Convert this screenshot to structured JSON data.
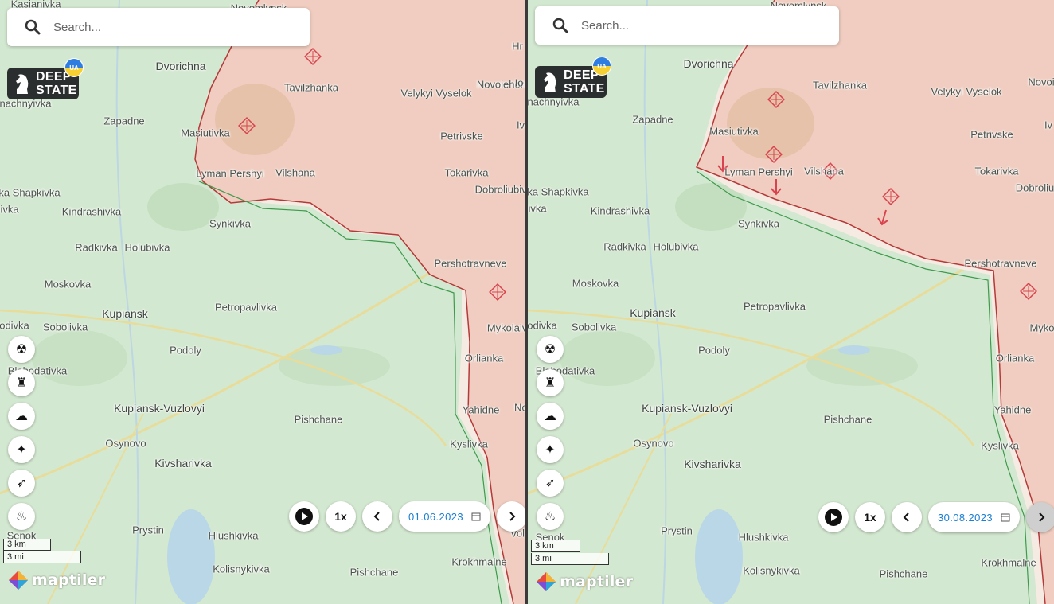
{
  "search": {
    "placeholder": "Search..."
  },
  "logo": {
    "line1": "DEEP",
    "line2": "STATE",
    "badge": "UA"
  },
  "colors": {
    "occupied": "#f0cdc0",
    "grey_zone": "#f6ebe2",
    "land": "#d3e8d0",
    "frontline": "#b43a3a",
    "date_text": "#1b7fd4"
  },
  "tools": [
    "radiation-icon",
    "monument-icon",
    "explosion-icon",
    "artillery-icon",
    "rocket-icon",
    "fire-icon"
  ],
  "panels": [
    {
      "date": "01.06.2023",
      "speed": "1x",
      "scale": {
        "km": "3 km",
        "mi": "3 mi"
      },
      "attribution": "maptiler",
      "places": [
        "Kasianivka",
        "Novomlynsk",
        "Dvorichna",
        "Tavilzhanka",
        "Velykyi Vyselok",
        "Novoiehorivka",
        "nachnyivka",
        "Zapadne",
        "Masiutivka",
        "Petrivske",
        "Lyman Pershyi",
        "Vilshana",
        "Tokarivka",
        "Dobroliubivka",
        "ka Shapkivka",
        "ivka",
        "Kindrashivka",
        "Synkivka",
        "Radkivka",
        "Holubivka",
        "Pershotravneve",
        "Moskovka",
        "Petropavlivka",
        "Kupiansk",
        "Sobolivka",
        "odivka",
        "Mykolaivka",
        "Podoly",
        "Orlianka",
        "Blahodativka",
        "Kupiansk-Vuzlovyi",
        "Pishchane",
        "Yahidne",
        "Osynovo",
        "Kivsharivka",
        "Kyslivka",
        "Senok",
        "Prystin",
        "Hlushkivka",
        "Kolisnykivka",
        "Pishchane",
        "Krokhmalne",
        "Vol",
        "Hr",
        "Io",
        "Iv",
        "Nc"
      ]
    },
    {
      "date": "30.08.2023",
      "speed": "1x",
      "scale": {
        "km": "3 km",
        "mi": "3 mi"
      },
      "attribution": "maptiler",
      "places": [
        "Novomlynsk",
        "Dvorichna",
        "Tavilzhanka",
        "Velykyi Vyselok",
        "Novoi",
        "nachnyivka",
        "Zapadne",
        "Masiutivka",
        "Petrivske",
        "Lyman Pershyi",
        "Vilshana",
        "Tokarivka",
        "Dobroliu",
        "ka Shapkivka",
        "ivka",
        "Kindrashivka",
        "Synkivka",
        "Radkivka",
        "Holubivka",
        "Pershotravneve",
        "Moskovka",
        "Petropavlivka",
        "Kupiansk",
        "Sobolivka",
        "odivka",
        "Myko",
        "Podoly",
        "Orlianka",
        "Blahodativka",
        "Kupiansk-Vuzlovyi",
        "Pishchane",
        "Yahidne",
        "Osynovo",
        "Kivsharivka",
        "Kyslivka",
        "Senok",
        "Prystin",
        "Hlushkivka",
        "Kolisnykivka",
        "Pishchane",
        "Krokhmalne",
        "Iv"
      ]
    }
  ]
}
